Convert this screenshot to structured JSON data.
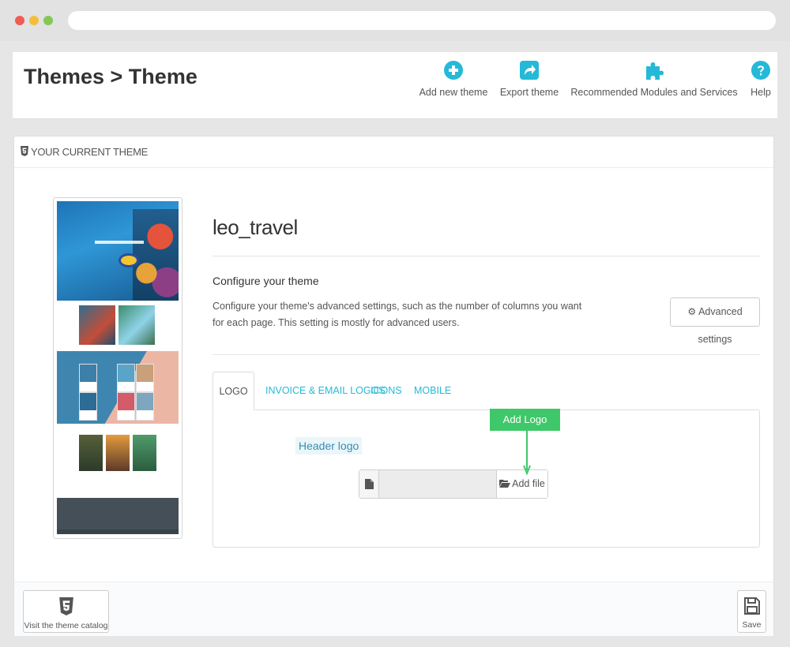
{
  "page": {
    "breadcrumb": "Themes > Theme"
  },
  "toolbar": {
    "add_new_theme": "Add new theme",
    "export_theme": "Export theme",
    "recommended_modules": "Recommended Modules and Services",
    "help": "Help"
  },
  "panel": {
    "heading": "YOUR CURRENT THEME",
    "theme_name": "leo_travel",
    "configure_title": "Configure your theme",
    "configure_description": "Configure your theme's advanced settings, such as the number of columns you want for each page. This setting is mostly for advanced users.",
    "advanced_settings_label": "Advanced settings"
  },
  "tabs": [
    {
      "label": "LOGO",
      "active": true
    },
    {
      "label": "INVOICE & EMAIL LOGOS",
      "active": false
    },
    {
      "label": "ICONS",
      "active": false
    },
    {
      "label": "MOBILE",
      "active": false
    }
  ],
  "logo_tab": {
    "header_logo_label": "Header logo",
    "file_input_value": "",
    "add_file_label": "Add file",
    "annotation": "Add Logo"
  },
  "footer": {
    "visit_catalog_label": "Visit the theme catalog",
    "save_label": "Save"
  },
  "colors": {
    "accent": "#25b9d7",
    "annotation": "#3fc86a",
    "text": "#555555"
  },
  "icons": {
    "add_new_theme": "plus-circle-icon",
    "export_theme": "share-arrow-icon",
    "recommended_modules": "puzzle-piece-icon",
    "help": "question-circle-icon",
    "panel_heading": "html5-icon",
    "advanced_settings": "gear-icon",
    "file": "file-icon",
    "add_file": "folder-open-icon",
    "catalog": "html5-icon",
    "save": "floppy-disk-icon"
  }
}
